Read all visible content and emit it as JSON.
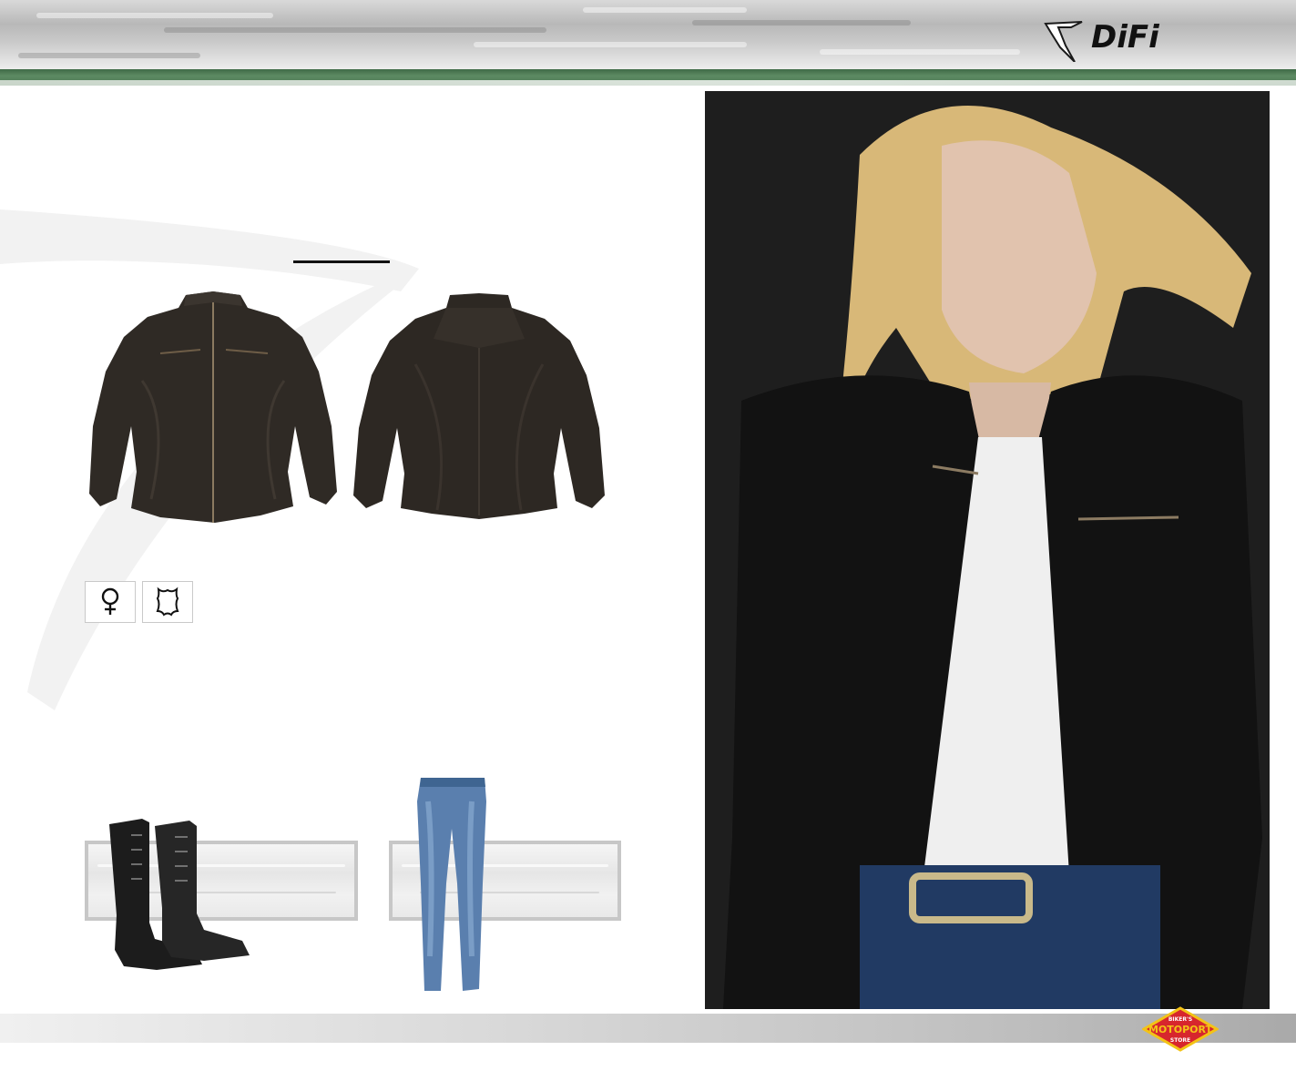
{
  "brand": {
    "logo_text": "DiFi"
  },
  "feature_icons": [
    {
      "icon": "female-symbol-icon",
      "glyph": "♀"
    },
    {
      "icon": "leather-hide-icon"
    }
  ],
  "accessories": [
    {
      "icon": "boots-image"
    },
    {
      "icon": "jeans-image"
    }
  ],
  "store_badge": {
    "top": "BIKER'S",
    "middle": "MOTOPORT",
    "bottom": "STORE"
  },
  "colors": {
    "green_band": "#4a7651",
    "badge_red": "#d7262d",
    "badge_yellow": "#f3c316"
  }
}
